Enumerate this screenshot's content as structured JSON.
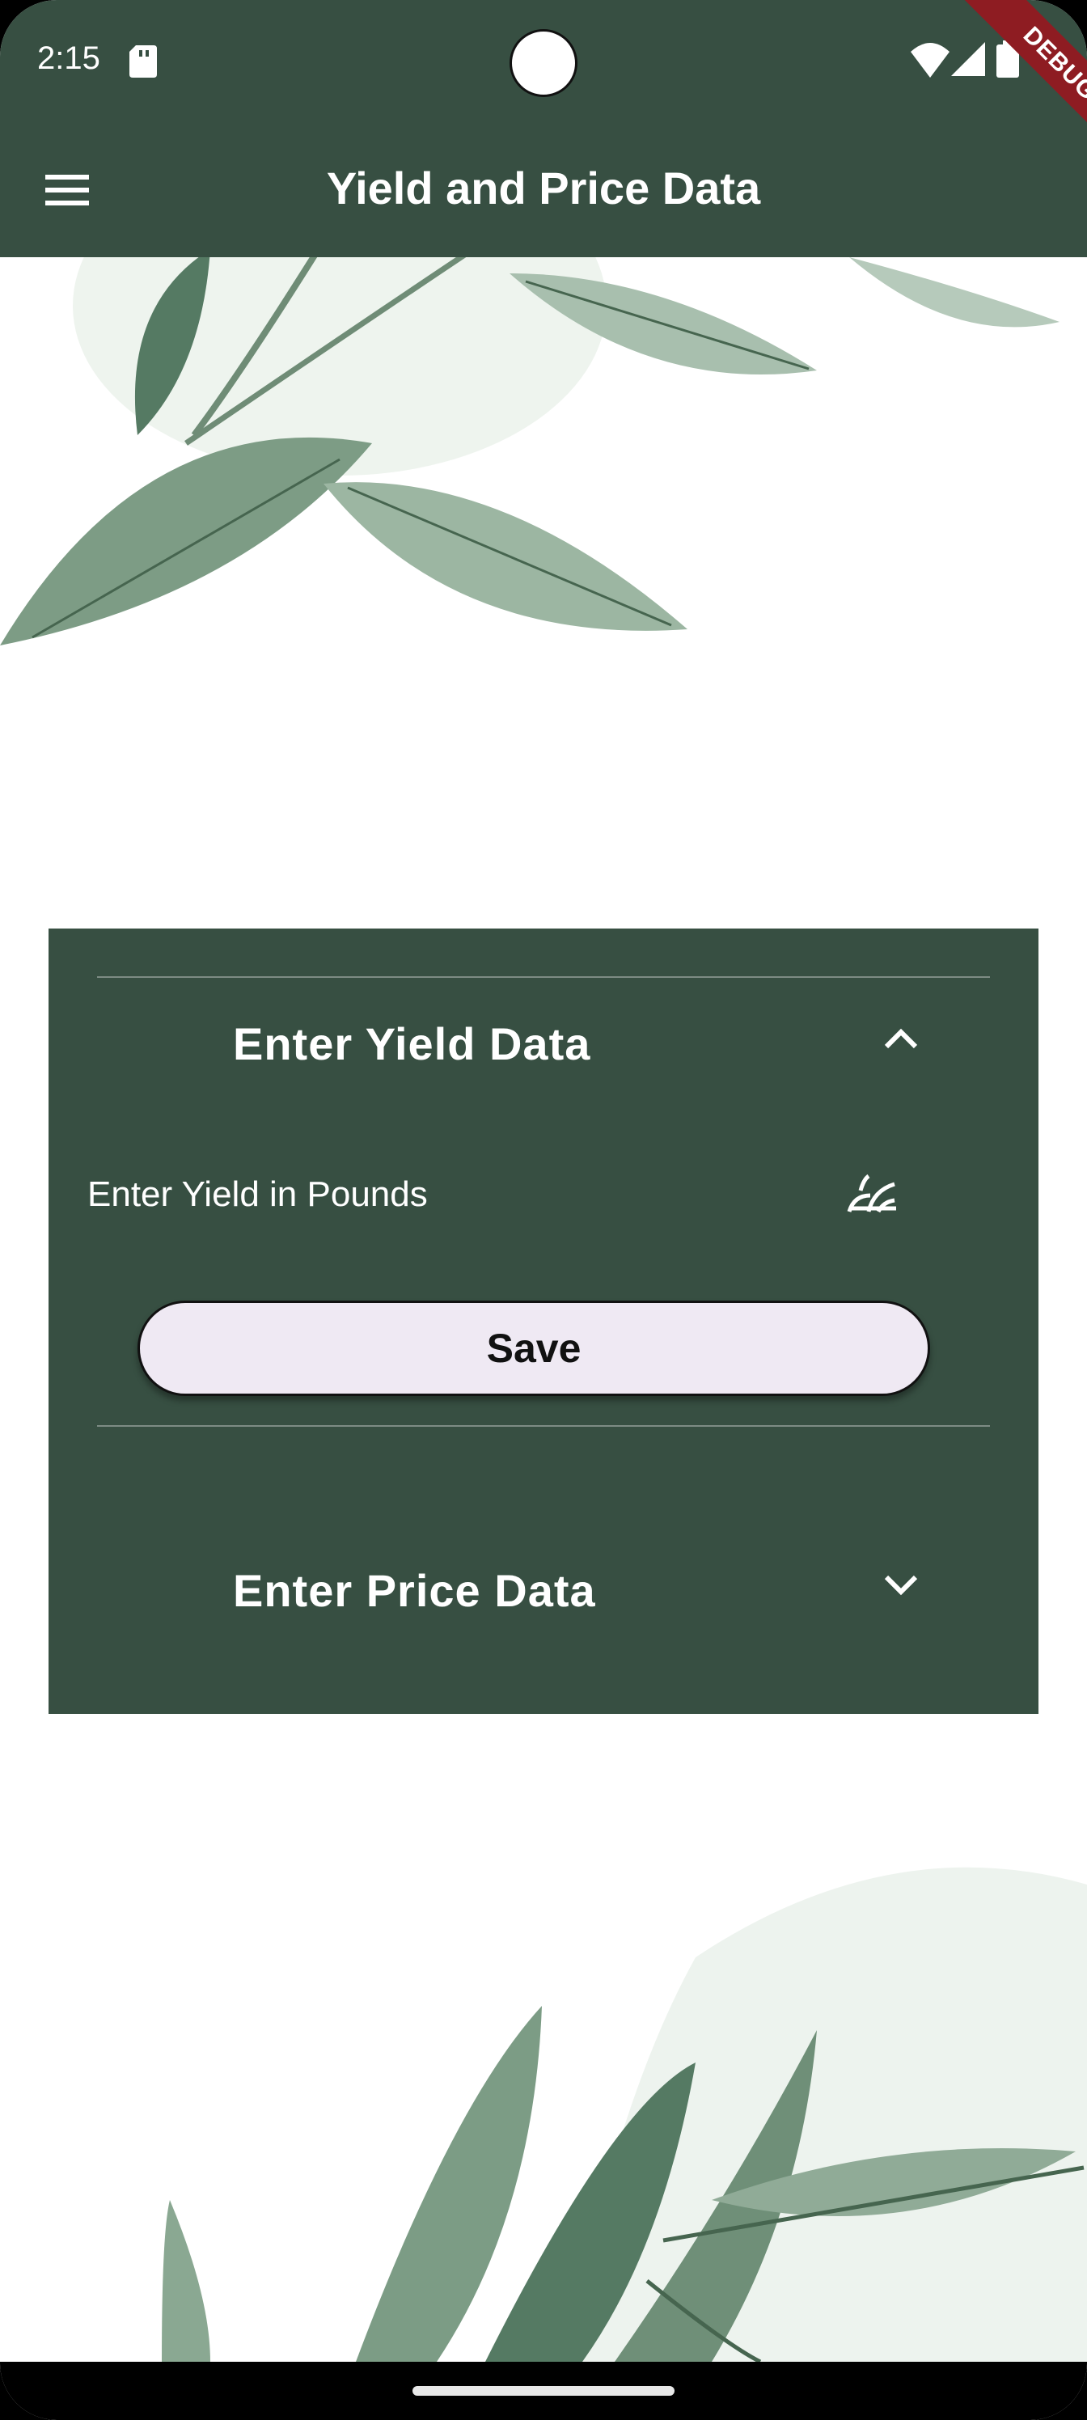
{
  "status_bar": {
    "time": "2:15",
    "icons": [
      "sd-card-icon",
      "wifi-icon",
      "signal-icon",
      "battery-icon"
    ],
    "debug_label": "DEBUG"
  },
  "app_bar": {
    "title": "Yield and Price Data",
    "menu_icon": "menu-icon"
  },
  "panels": {
    "yield": {
      "title": "Enter Yield Data",
      "expanded": true,
      "field_label": "Enter Yield in Pounds",
      "field_icon": "grass-icon",
      "save_label": "Save"
    },
    "price": {
      "title": "Enter Price Data",
      "expanded": false
    }
  },
  "colors": {
    "primary": "#374f42",
    "button_bg": "#efe9f3",
    "debug_ribbon": "#8e1c22"
  }
}
